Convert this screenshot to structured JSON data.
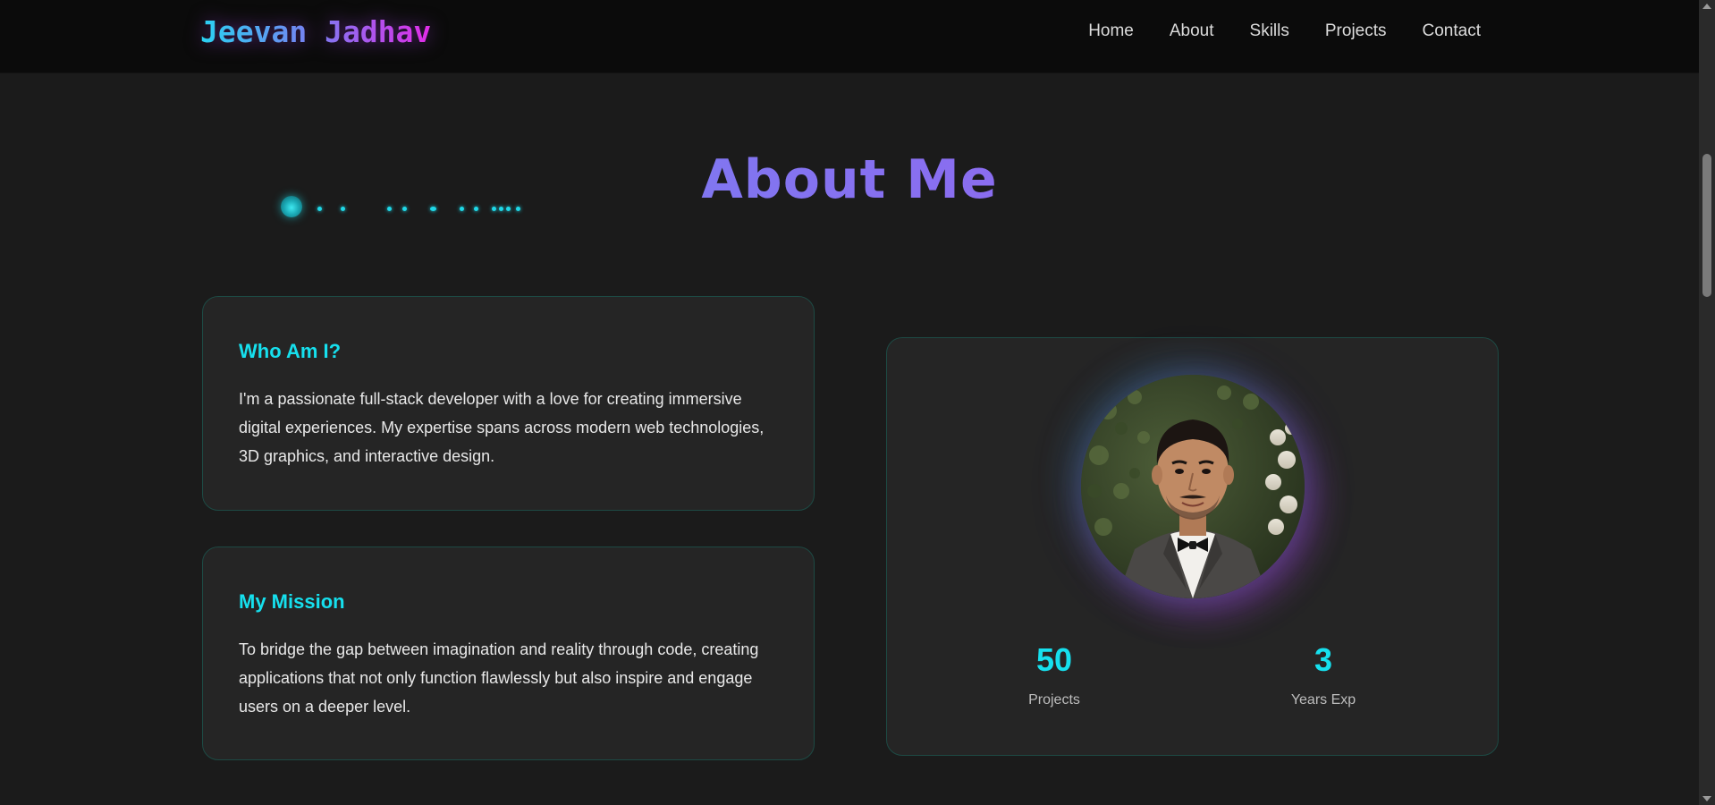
{
  "navbar": {
    "brand": "Jeevan Jadhav",
    "links": [
      "Home",
      "About",
      "Skills",
      "Projects",
      "Contact"
    ]
  },
  "section": {
    "title": "About Me"
  },
  "who": {
    "heading": "Who Am I?",
    "text": "I'm a passionate full-stack developer with a love for creating immersive digital experiences. My expertise spans across modern web technologies, 3D graphics, and interactive design."
  },
  "mission": {
    "heading": "My Mission",
    "text": "To bridge the gap between imagination and reality through code, creating applications that not only function flawlessly but also inspire and engage users on a deeper level."
  },
  "stats": [
    {
      "value": "50",
      "label": "Projects"
    },
    {
      "value": "3",
      "label": "Years Exp"
    }
  ],
  "colors": {
    "accent_cyan": "#16e0ee",
    "accent_purple": "#8b6cf0",
    "background": "#1b1b1b",
    "card": "#252525",
    "card_border": "#1d4a44",
    "navbar": "#0b0b0b"
  },
  "icons": {
    "scroll_up": "chevron-up-icon",
    "scroll_down": "chevron-down-icon"
  }
}
